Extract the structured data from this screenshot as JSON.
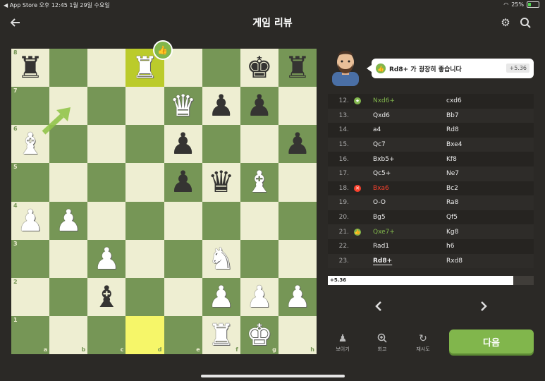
{
  "status_bar": {
    "left": "◀ App Store  오후 12:45   1월 29일 수요일",
    "battery": "25%"
  },
  "header": {
    "title": "게임 리뷰"
  },
  "board": {
    "ranks": [
      "8",
      "7",
      "6",
      "5",
      "4",
      "3",
      "2",
      "1"
    ],
    "files": [
      "a",
      "b",
      "c",
      "d",
      "e",
      "f",
      "g",
      "h"
    ],
    "rows": [
      [
        "bR",
        "",
        "",
        "wR",
        "",
        "",
        "bK",
        "bR"
      ],
      [
        "",
        "",
        "",
        "",
        "wQ",
        "bP",
        "bP",
        ""
      ],
      [
        "wB",
        "",
        "",
        "",
        "bP",
        "",
        "",
        "bP"
      ],
      [
        "",
        "",
        "",
        "",
        "bP",
        "bQ",
        "wB",
        ""
      ],
      [
        "wP",
        "wP",
        "",
        "",
        "",
        "",
        "",
        ""
      ],
      [
        "",
        "",
        "wP",
        "",
        "",
        "wN",
        "",
        ""
      ],
      [
        "",
        "",
        "bB",
        "",
        "",
        "wP",
        "wP",
        "wP"
      ],
      [
        "",
        "",
        "",
        "",
        "",
        "wR",
        "wK",
        ""
      ]
    ],
    "highlight_squares": [
      "d8",
      "d1"
    ],
    "best_move_badge_square": "d8",
    "suggested_arrow": "a6→b7"
  },
  "coach": {
    "message": "Rd8+ 가 굉장히 좋습니다",
    "eval": "+5.36"
  },
  "moves": [
    {
      "num": "12.",
      "icon": "star",
      "white": "Nxd6+",
      "black": "cxd6",
      "white_color": "#81b64c"
    },
    {
      "num": "13.",
      "icon": "",
      "white": "Qxd6",
      "black": "Bb7"
    },
    {
      "num": "14.",
      "icon": "",
      "white": "a4",
      "black": "Rd8"
    },
    {
      "num": "15.",
      "icon": "",
      "white": "Qc7",
      "black": "Bxe4"
    },
    {
      "num": "16.",
      "icon": "",
      "white": "Bxb5+",
      "black": "Kf8"
    },
    {
      "num": "17.",
      "icon": "",
      "white": "Qc5+",
      "black": "Ne7"
    },
    {
      "num": "18.",
      "icon": "x",
      "white": "Bxa6",
      "black": "Bc2",
      "white_color": "#fa412d"
    },
    {
      "num": "19.",
      "icon": "",
      "white": "O-O",
      "black": "Ra8"
    },
    {
      "num": "20.",
      "icon": "",
      "white": "Bg5",
      "black": "Qf5"
    },
    {
      "num": "21.",
      "icon": "thumb",
      "white": "Qxe7+",
      "black": "Kg8",
      "white_color": "#81b64c"
    },
    {
      "num": "22.",
      "icon": "",
      "white": "Rad1",
      "black": "h6"
    },
    {
      "num": "23.",
      "icon": "",
      "white": "Rd8+",
      "black": "Rxd8",
      "current": true
    }
  ],
  "eval_bar": {
    "label": "+5.36",
    "white_fraction": 0.9
  },
  "toolbar": {
    "show": "보이기",
    "retry": "회고",
    "replay": "재시도",
    "next": "다음"
  },
  "colors": {
    "accent": "#81b64c",
    "blunder": "#fa412d",
    "light_square": "#eeeed2",
    "dark_square": "#769656"
  }
}
